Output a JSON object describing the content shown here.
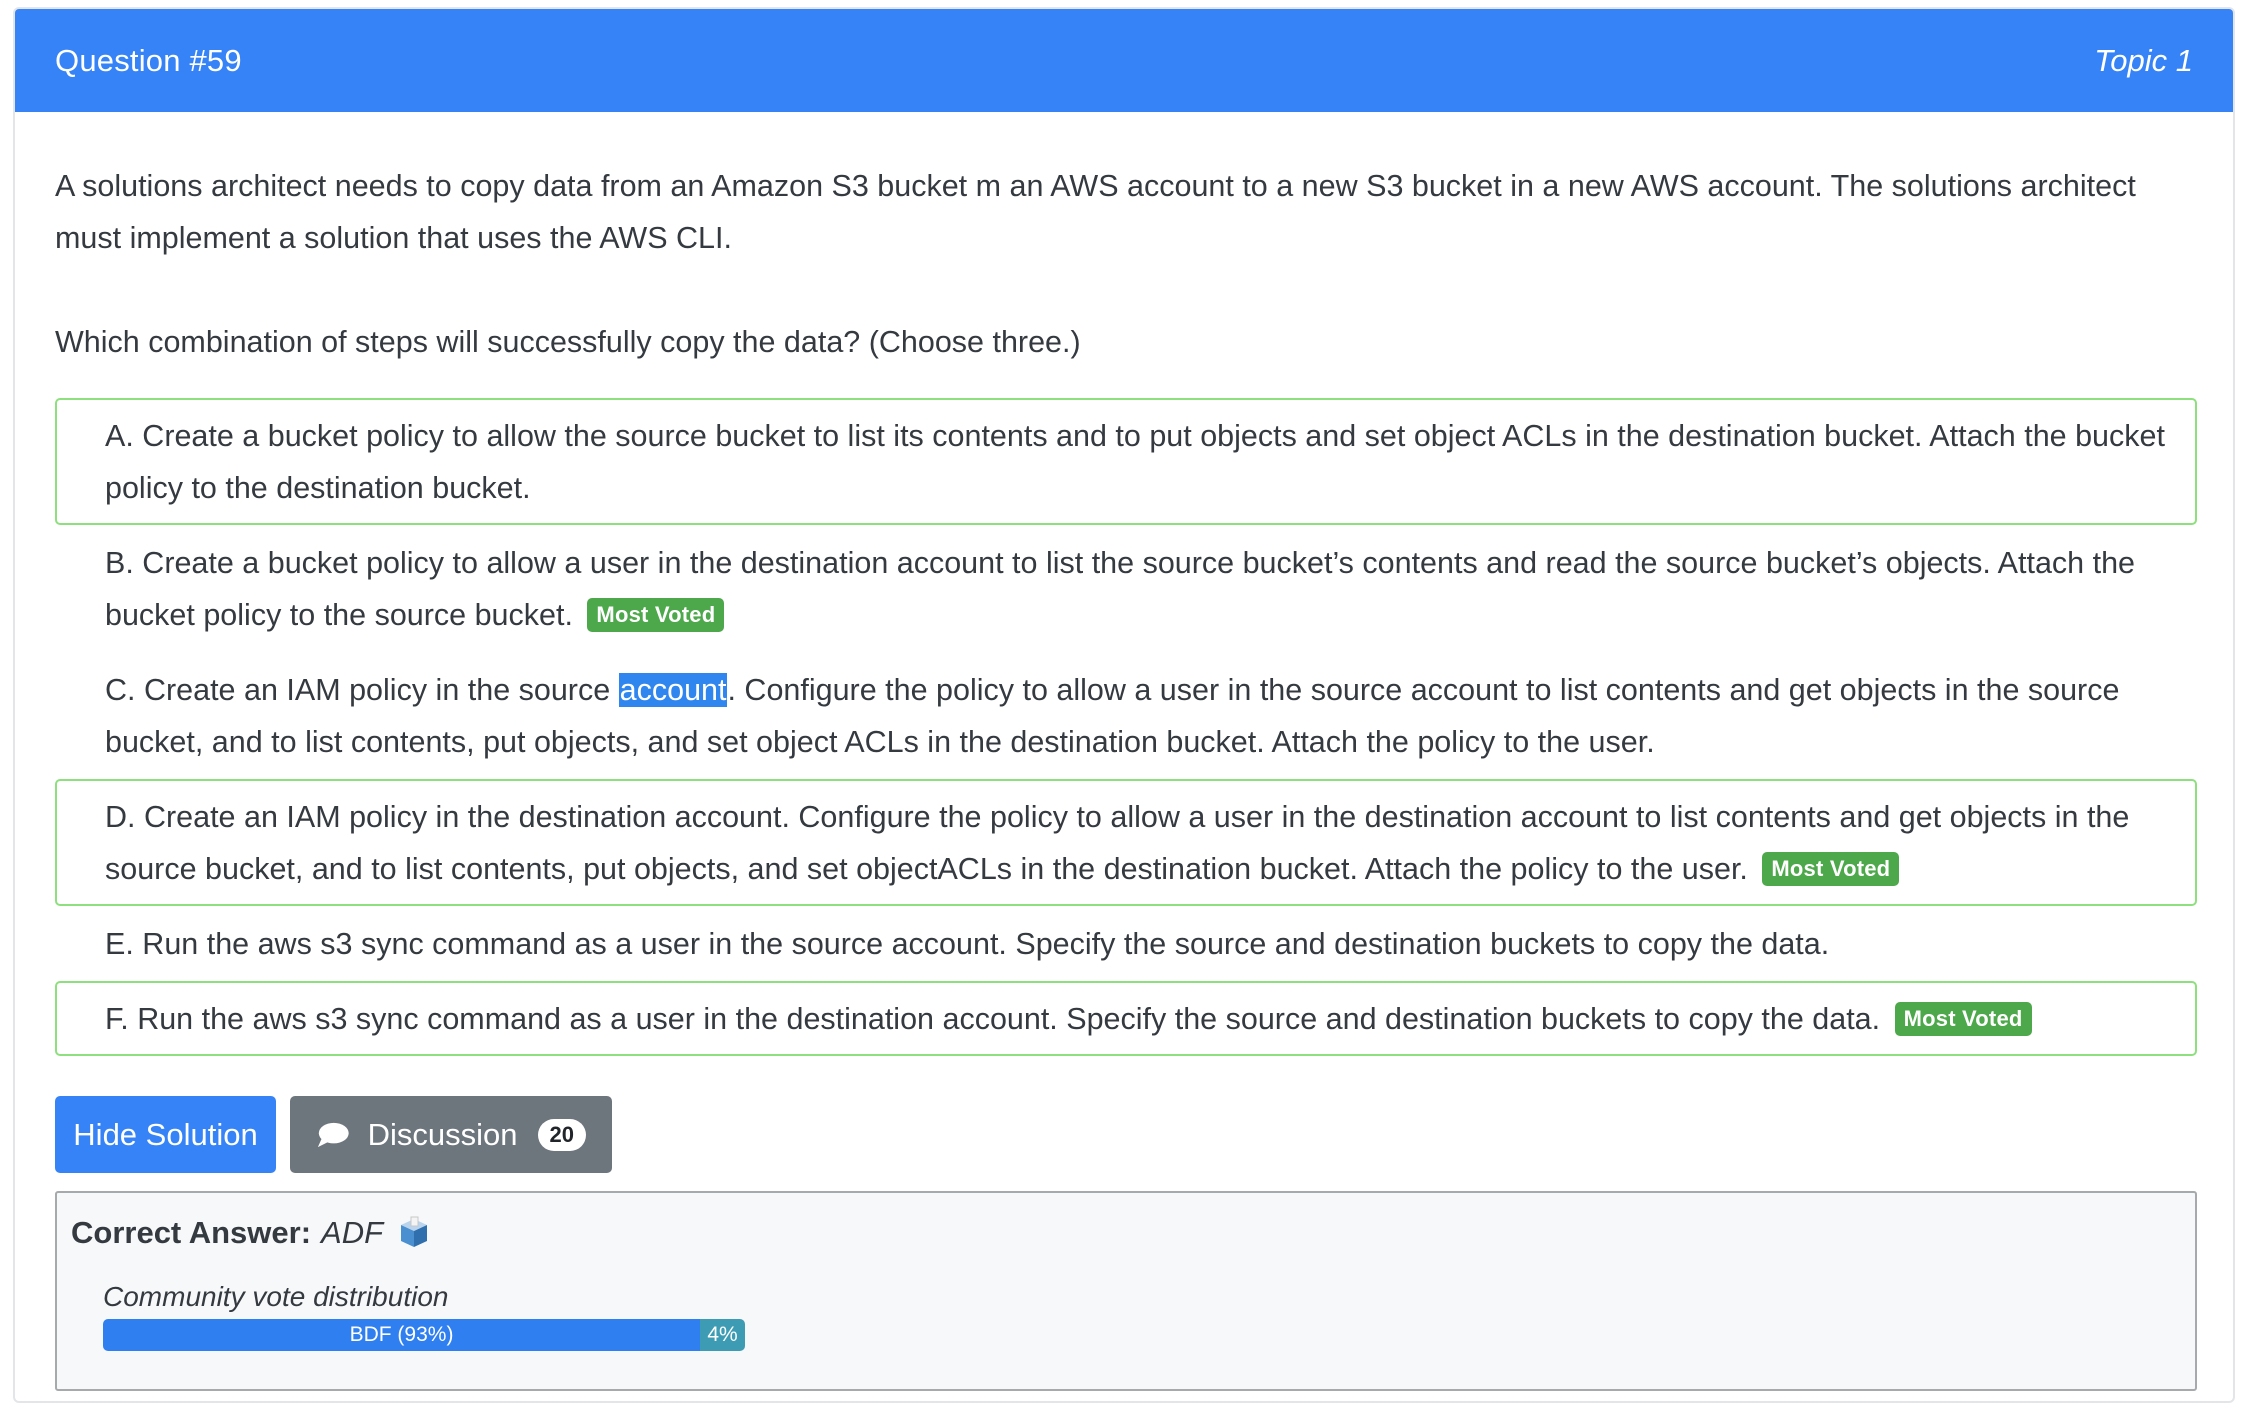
{
  "header": {
    "question_label": "Question #59",
    "topic_label": "Topic 1"
  },
  "question": {
    "text": "A solutions architect needs to copy data from an Amazon S3 bucket m an AWS account to a new S3 bucket in a new AWS account. The solutions architect must implement a solution that uses the AWS CLI.",
    "prompt": "Which combination of steps will successfully copy the data? (Choose three.)"
  },
  "choices": [
    {
      "text": "A. Create a bucket policy to allow the source bucket to list its contents and to put objects and set object ACLs in the destination bucket. Attach the bucket policy to the destination bucket.",
      "correct": true,
      "most_voted": false
    },
    {
      "text": "B. Create a bucket policy to allow a user in the destination account to list the source bucket’s contents and read the source bucket’s objects. Attach the bucket policy to the source bucket.",
      "correct": false,
      "most_voted": true
    },
    {
      "text_before": "C. Create an IAM policy in the source ",
      "highlight": "account",
      "text_after": ". Configure the policy to allow a user in the source account to list contents and get objects in the source bucket, and to list contents, put objects, and set object ACLs in the destination bucket. Attach the policy to the user.",
      "correct": false,
      "most_voted": false
    },
    {
      "text": "D. Create an IAM policy in the destination account. Configure the policy to allow a user in the destination account to list contents and get objects in the source bucket, and to list contents, put objects, and set objectACLs in the destination bucket. Attach the policy to the user.",
      "correct": true,
      "most_voted": true
    },
    {
      "text": "E. Run the aws s3 sync command as a user in the source account. Specify the source and destination buckets to copy the data.",
      "correct": false,
      "most_voted": false
    },
    {
      "text": "F. Run the aws s3 sync command as a user in the destination account. Specify the source and destination buckets to copy the data.",
      "correct": true,
      "most_voted": true
    }
  ],
  "most_voted_label": "Most Voted",
  "buttons": {
    "hide_solution": "Hide Solution",
    "discussion": "Discussion",
    "discussion_count": "20"
  },
  "answer": {
    "label": "Correct Answer:",
    "value": "ADF",
    "vote_label": "Community vote distribution",
    "votes": [
      {
        "label": "BDF (93%)",
        "percent": 93
      },
      {
        "label": "4%",
        "percent": 7
      }
    ]
  },
  "colors": {
    "primary": "#3583f7",
    "correct_border": "#8ee07f",
    "badge": "#4ca84a",
    "secondary": "#6d757d"
  },
  "icons": {
    "discussion": "chat-bubble-icon",
    "answer": "ballot-box-icon"
  }
}
